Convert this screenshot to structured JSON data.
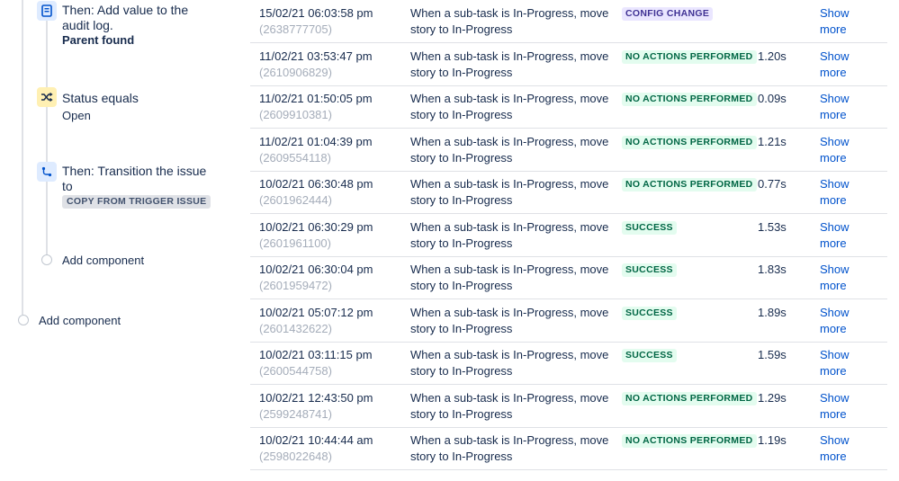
{
  "rule_tree": {
    "audit_node": {
      "icon": "audit-log-icon",
      "title_line1": "Then: Add value to the",
      "title_line2": "audit log.",
      "detail": "Parent found"
    },
    "status_node": {
      "icon": "shuffle-icon",
      "title": "Status equals",
      "detail": "Open"
    },
    "transition_node": {
      "icon": "transition-icon",
      "title_line1": "Then: Transition the issue",
      "title_line2": "to",
      "detail": "COPY FROM TRIGGER ISSUE"
    },
    "add_component_inner": "Add component",
    "add_component_outer": "Add component"
  },
  "status_colors": {
    "CONFIG CHANGE": {
      "bg": "#eae6ff",
      "fg": "#403294"
    },
    "NO ACTIONS PERFORMED": {
      "bg": "#e3fcef",
      "fg": "#006644"
    },
    "SUCCESS": {
      "bg": "#e3fcef",
      "fg": "#006644"
    }
  },
  "audit_log": {
    "rows": [
      {
        "date": "15/02/21 06:03:58 pm",
        "execution_id": "(2638777705)",
        "rule_line1": "When a sub-task is In-Progress, move",
        "rule_line2": "story to In-Progress",
        "status": "CONFIG CHANGE",
        "duration": "",
        "action_line1": "Show",
        "action_line2": "more"
      },
      {
        "date": "11/02/21 03:53:47 pm",
        "execution_id": "(2610906829)",
        "rule_line1": "When a sub-task is In-Progress, move",
        "rule_line2": "story to In-Progress",
        "status": "NO ACTIONS PERFORMED",
        "duration": "1.20s",
        "action_line1": "Show",
        "action_line2": "more"
      },
      {
        "date": "11/02/21 01:50:05 pm",
        "execution_id": "(2609910381)",
        "rule_line1": "When a sub-task is In-Progress, move",
        "rule_line2": "story to In-Progress",
        "status": "NO ACTIONS PERFORMED",
        "duration": "0.09s",
        "action_line1": "Show",
        "action_line2": "more"
      },
      {
        "date": "11/02/21 01:04:39 pm",
        "execution_id": "(2609554118)",
        "rule_line1": "When a sub-task is In-Progress, move",
        "rule_line2": "story to In-Progress",
        "status": "NO ACTIONS PERFORMED",
        "duration": "1.21s",
        "action_line1": "Show",
        "action_line2": "more"
      },
      {
        "date": "10/02/21 06:30:48 pm",
        "execution_id": "(2601962444)",
        "rule_line1": "When a sub-task is In-Progress, move",
        "rule_line2": "story to In-Progress",
        "status": "NO ACTIONS PERFORMED",
        "duration": "0.77s",
        "action_line1": "Show",
        "action_line2": "more"
      },
      {
        "date": "10/02/21 06:30:29 pm",
        "execution_id": "(2601961100)",
        "rule_line1": "When a sub-task is In-Progress, move",
        "rule_line2": "story to In-Progress",
        "status": "SUCCESS",
        "duration": "1.53s",
        "action_line1": "Show",
        "action_line2": "more"
      },
      {
        "date": "10/02/21 06:30:04 pm",
        "execution_id": "(2601959472)",
        "rule_line1": "When a sub-task is In-Progress, move",
        "rule_line2": "story to In-Progress",
        "status": "SUCCESS",
        "duration": "1.83s",
        "action_line1": "Show",
        "action_line2": "more"
      },
      {
        "date": "10/02/21 05:07:12 pm",
        "execution_id": "(2601432622)",
        "rule_line1": "When a sub-task is In-Progress, move",
        "rule_line2": "story to In-Progress",
        "status": "SUCCESS",
        "duration": "1.89s",
        "action_line1": "Show",
        "action_line2": "more"
      },
      {
        "date": "10/02/21 03:11:15 pm",
        "execution_id": "(2600544758)",
        "rule_line1": "When a sub-task is In-Progress, move",
        "rule_line2": "story to In-Progress",
        "status": "SUCCESS",
        "duration": "1.59s",
        "action_line1": "Show",
        "action_line2": "more"
      },
      {
        "date": "10/02/21 12:43:50 pm",
        "execution_id": "(2599248741)",
        "rule_line1": "When a sub-task is In-Progress, move",
        "rule_line2": "story to In-Progress",
        "status": "NO ACTIONS PERFORMED",
        "duration": "1.29s",
        "action_line1": "Show",
        "action_line2": "more"
      },
      {
        "date": "10/02/21 10:44:44 am",
        "execution_id": "(2598022648)",
        "rule_line1": "When a sub-task is In-Progress, move",
        "rule_line2": "story to In-Progress",
        "status": "NO ACTIONS PERFORMED",
        "duration": "1.19s",
        "action_line1": "Show",
        "action_line2": "more"
      }
    ]
  }
}
